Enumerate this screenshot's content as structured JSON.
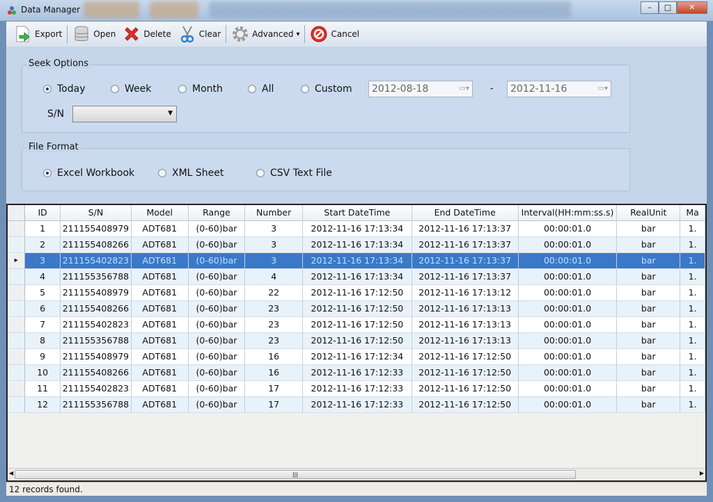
{
  "window": {
    "title": "Data Manager",
    "minimize": "–",
    "maximize": "□",
    "close": "✕"
  },
  "toolbar": {
    "export": "Export",
    "open": "Open",
    "delete": "Delete",
    "clear": "Clear",
    "advanced": "Advanced",
    "advanced_arrow": "▾",
    "cancel": "Cancel"
  },
  "seek": {
    "title": "Seek Options",
    "options": [
      "Today",
      "Week",
      "Month",
      "All",
      "Custom"
    ],
    "selected": "Today",
    "date_from": "2012-08-18",
    "date_to": "2012-11-16",
    "dash": "-",
    "sn_label": "S/N",
    "sn_value": ""
  },
  "format": {
    "title": "File Format",
    "options": [
      "Excel Workbook",
      "XML Sheet",
      "CSV Text File"
    ],
    "selected": "Excel Workbook"
  },
  "table": {
    "columns": [
      "ID",
      "S/N",
      "Model",
      "Range",
      "Number",
      "Start DateTime",
      "End DateTime",
      "Interval(HH:mm:ss.s)",
      "RealUnit",
      "Ma"
    ],
    "selected_row": 3,
    "rows": [
      [
        "1",
        "211155408979",
        "ADT681",
        "(0-60)bar",
        "3",
        "2012-11-16 17:13:34",
        "2012-11-16 17:13:37",
        "00:00:01.0",
        "bar",
        "1."
      ],
      [
        "2",
        "211155408266",
        "ADT681",
        "(0-60)bar",
        "3",
        "2012-11-16 17:13:34",
        "2012-11-16 17:13:37",
        "00:00:01.0",
        "bar",
        "1."
      ],
      [
        "3",
        "211155402823",
        "ADT681",
        "(0-60)bar",
        "3",
        "2012-11-16 17:13:34",
        "2012-11-16 17:13:37",
        "00:00:01.0",
        "bar",
        "1."
      ],
      [
        "4",
        "211155356788",
        "ADT681",
        "(0-60)bar",
        "4",
        "2012-11-16 17:13:34",
        "2012-11-16 17:13:37",
        "00:00:01.0",
        "bar",
        "1."
      ],
      [
        "5",
        "211155408979",
        "ADT681",
        "(0-60)bar",
        "22",
        "2012-11-16 17:12:50",
        "2012-11-16 17:13:12",
        "00:00:01.0",
        "bar",
        "1."
      ],
      [
        "6",
        "211155408266",
        "ADT681",
        "(0-60)bar",
        "23",
        "2012-11-16 17:12:50",
        "2012-11-16 17:13:13",
        "00:00:01.0",
        "bar",
        "1."
      ],
      [
        "7",
        "211155402823",
        "ADT681",
        "(0-60)bar",
        "23",
        "2012-11-16 17:12:50",
        "2012-11-16 17:13:13",
        "00:00:01.0",
        "bar",
        "1."
      ],
      [
        "8",
        "211155356788",
        "ADT681",
        "(0-60)bar",
        "23",
        "2012-11-16 17:12:50",
        "2012-11-16 17:13:13",
        "00:00:01.0",
        "bar",
        "1."
      ],
      [
        "9",
        "211155408979",
        "ADT681",
        "(0-60)bar",
        "16",
        "2012-11-16 17:12:34",
        "2012-11-16 17:12:50",
        "00:00:01.0",
        "bar",
        "1."
      ],
      [
        "10",
        "211155408266",
        "ADT681",
        "(0-60)bar",
        "16",
        "2012-11-16 17:12:33",
        "2012-11-16 17:12:50",
        "00:00:01.0",
        "bar",
        "1."
      ],
      [
        "11",
        "211155402823",
        "ADT681",
        "(0-60)bar",
        "17",
        "2012-11-16 17:12:33",
        "2012-11-16 17:12:50",
        "00:00:01.0",
        "bar",
        "1."
      ],
      [
        "12",
        "211155356788",
        "ADT681",
        "(0-60)bar",
        "17",
        "2012-11-16 17:12:33",
        "2012-11-16 17:12:50",
        "00:00:01.0",
        "bar",
        "1."
      ]
    ]
  },
  "status": {
    "text": "12 records found."
  },
  "colors": {
    "selection": "#3c78c8",
    "alt_row": "#e8f2fb",
    "panel": "#c5d5ea"
  }
}
